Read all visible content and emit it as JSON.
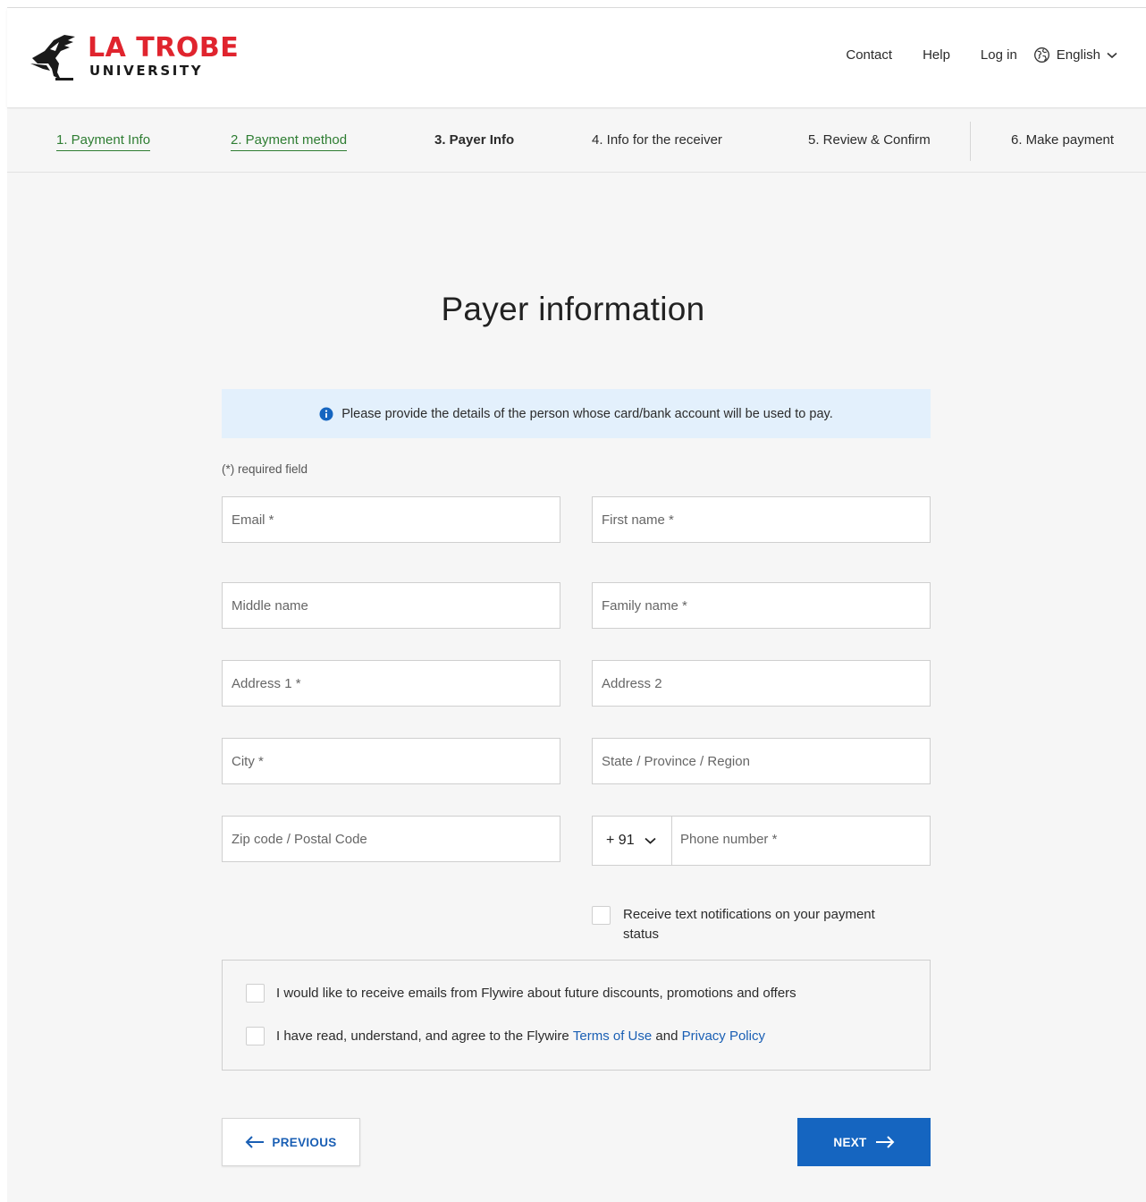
{
  "header": {
    "logo": {
      "line1": "LA TROBE",
      "line2": "UNIVERSITY",
      "icon": "eagle-logo-icon"
    },
    "nav": {
      "contact": "Contact",
      "help": "Help",
      "login": "Log in",
      "language": "English",
      "language_icon": "globe-icon"
    }
  },
  "steps": [
    {
      "label": "1. Payment Info",
      "state": "done"
    },
    {
      "label": "2. Payment method",
      "state": "done"
    },
    {
      "label": "3. Payer Info",
      "state": "active"
    },
    {
      "label": "4. Info for the receiver",
      "state": "todo"
    },
    {
      "label": "5. Review & Confirm",
      "state": "todo"
    },
    {
      "label": "6. Make payment",
      "state": "todo"
    }
  ],
  "page": {
    "title": "Payer information",
    "info": "Please provide the details of the person whose card/bank account will be used to pay.",
    "required_note": "(*) required field"
  },
  "form": {
    "email": {
      "placeholder": "Email *",
      "value": ""
    },
    "first_name": {
      "placeholder": "First name *",
      "value": ""
    },
    "middle_name": {
      "placeholder": "Middle name",
      "value": ""
    },
    "family_name": {
      "placeholder": "Family name *",
      "value": ""
    },
    "address1": {
      "placeholder": "Address 1 *",
      "value": ""
    },
    "address2": {
      "placeholder": "Address 2",
      "value": ""
    },
    "city": {
      "placeholder": "City *",
      "value": ""
    },
    "state": {
      "placeholder": "State / Province / Region",
      "value": ""
    },
    "zip": {
      "placeholder": "Zip code / Postal Code",
      "value": ""
    },
    "phone_code": "+ 91",
    "phone": {
      "placeholder": "Phone number *",
      "value": ""
    },
    "sms_label": "Receive text notifications on your payment status"
  },
  "consent": {
    "marketing": "I would like to receive emails from Flywire about future discounts, promotions and offers",
    "terms_prefix": "I have read, understand, and agree to the Flywire ",
    "terms_link": "Terms of Use",
    "terms_and": " and ",
    "privacy_link": "Privacy Policy"
  },
  "buttons": {
    "previous": "PREVIOUS",
    "next": "NEXT"
  },
  "colors": {
    "brand_red": "#e0242e",
    "done_green": "#2e7d32",
    "primary_blue": "#1565c0",
    "info_bg": "#e3f0fc"
  }
}
